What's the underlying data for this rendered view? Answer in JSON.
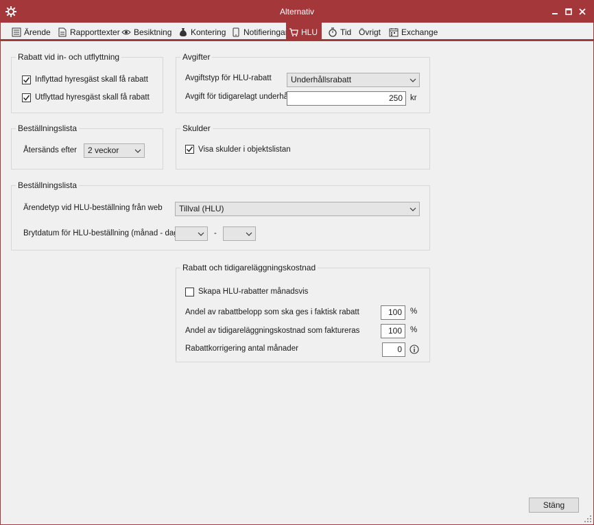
{
  "window": {
    "title": "Alternativ"
  },
  "tabs": [
    {
      "label": "Ärende",
      "icon": "list-icon"
    },
    {
      "label": "Rapporttexter",
      "icon": "document-icon"
    },
    {
      "label": "Besiktning",
      "icon": "eye-icon"
    },
    {
      "label": "Kontering",
      "icon": "money-bag-icon"
    },
    {
      "label": "Notifieringar",
      "icon": "phone-icon"
    },
    {
      "label": "HLU",
      "icon": "cart-icon",
      "active": true
    },
    {
      "label": "Tid",
      "icon": "stopwatch-icon"
    },
    {
      "label": "Övrigt",
      "icon": ""
    },
    {
      "label": "Exchange",
      "icon": "calendar-icon"
    }
  ],
  "rabatt_flytt": {
    "title": "Rabatt vid in- och utflyttning",
    "inflyttad_label": "Inflyttad hyresgäst skall få rabatt",
    "inflyttad_checked": true,
    "utflyttad_label": "Utflyttad hyresgäst skall få rabatt",
    "utflyttad_checked": true
  },
  "avgifter": {
    "title": "Avgifter",
    "avgiftstyp_label": "Avgiftstyp för HLU-rabatt",
    "avgiftstyp_value": "Underhållsrabatt",
    "avgift_label": "Avgift för tidigarelagt underhåll",
    "avgift_value": "250",
    "avgift_unit": "kr"
  },
  "bestallningslista_1": {
    "title": "Beställningslista",
    "atersands_label": "Återsänds efter",
    "atersands_value": "2 veckor"
  },
  "skulder": {
    "title": "Skulder",
    "visa_label": "Visa skulder i objektslistan",
    "visa_checked": true
  },
  "bestallningslista_2": {
    "title": "Beställningslista",
    "arendetyp_label": "Ärendetyp vid HLU-beställning från web",
    "arendetyp_value": "Tillval (HLU)",
    "brytdatum_label": "Brytdatum för HLU-beställning (månad - dag)",
    "brytdatum_separator": "-",
    "manad_value": "",
    "dag_value": ""
  },
  "rabatt_tidigare": {
    "title": "Rabatt och tidigareläggningskostnad",
    "skapa_label": "Skapa HLU-rabatter månadsvis",
    "skapa_checked": false,
    "andel_rabatt_label": "Andel av rabattbelopp som ska ges i faktisk rabatt",
    "andel_rabatt_value": "100",
    "andel_rabatt_unit": "%",
    "andel_kostnad_label": "Andel av tidigareläggningskostnad som faktureras",
    "andel_kostnad_value": "100",
    "andel_kostnad_unit": "%",
    "korrigering_label": "Rabattkorrigering antal månader",
    "korrigering_value": "0"
  },
  "footer": {
    "close_label": "Stäng"
  },
  "colors": {
    "accent": "#a4373a",
    "background": "#f0f0f0"
  }
}
